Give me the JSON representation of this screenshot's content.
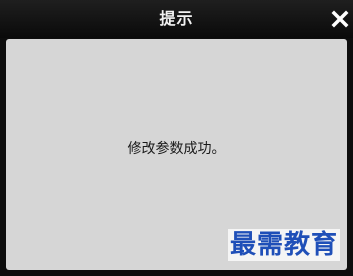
{
  "dialog": {
    "title": "提示",
    "close_icon": "close-icon",
    "message": "修改参数成功。"
  },
  "watermark": {
    "text": "最需教育"
  },
  "colors": {
    "titlebar": "#0d0d0d",
    "title_text": "#f2f2f2",
    "panel": "#d6d6d6",
    "watermark": "#1f4fb8"
  }
}
